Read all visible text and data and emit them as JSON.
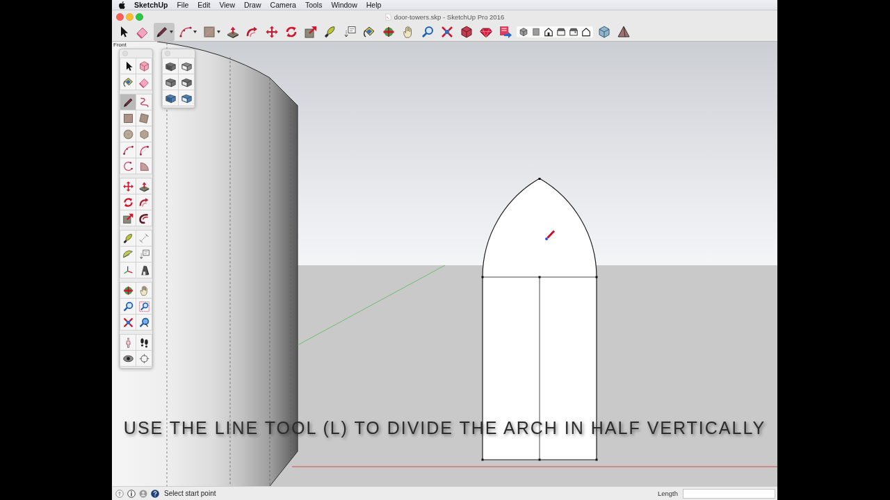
{
  "menu_bar": {
    "app_name": "SketchUp",
    "menus": [
      "File",
      "Edit",
      "View",
      "Draw",
      "Camera",
      "Tools",
      "Window",
      "Help"
    ]
  },
  "window": {
    "title": "door-towers.skp - SketchUp Pro 2016"
  },
  "toolbar": {
    "main_tools": [
      {
        "selected": false,
        "dropdown": false
      },
      {
        "selected": false,
        "dropdown": false
      },
      {
        "selected": true,
        "dropdown": true
      },
      {
        "selected": false,
        "dropdown": true
      },
      {
        "selected": false,
        "dropdown": true
      },
      {
        "selected": false,
        "dropdown": false
      },
      {
        "selected": false,
        "dropdown": false
      },
      {
        "selected": false,
        "dropdown": false
      },
      {
        "selected": false,
        "dropdown": false
      },
      {
        "selected": false,
        "dropdown": false
      },
      {
        "selected": false,
        "dropdown": false
      },
      {
        "selected": false,
        "dropdown": false
      },
      {
        "selected": false,
        "dropdown": false
      },
      {
        "selected": false,
        "dropdown": false
      },
      {
        "selected": false,
        "dropdown": false
      },
      {
        "selected": false,
        "dropdown": false
      },
      {
        "selected": false,
        "dropdown": false
      },
      {
        "selected": false,
        "dropdown": false
      },
      {
        "selected": false,
        "dropdown": false
      },
      {
        "selected": false,
        "dropdown": false
      }
    ]
  },
  "viewport": {
    "view_label": "Front",
    "caption": "USE THE LINE TOOL (L) TO DIVIDE THE ARCH IN HALF VERTICALLY"
  },
  "tool_palette": {
    "groups": [
      {
        "tools": [
          {
            "selected": false
          },
          {
            "selected": false
          },
          {
            "selected": false
          },
          {
            "selected": false
          }
        ]
      },
      {
        "tools": [
          {
            "selected": true
          },
          {
            "selected": false
          },
          {
            "selected": false
          },
          {
            "selected": false
          },
          {
            "selected": false
          },
          {
            "selected": false
          },
          {
            "selected": false
          },
          {
            "selected": false
          },
          {
            "selected": false
          },
          {
            "selected": false
          }
        ]
      },
      {
        "tools": [
          {
            "selected": false
          },
          {
            "selected": false
          },
          {
            "selected": false
          },
          {
            "selected": false
          },
          {
            "selected": false
          },
          {
            "selected": false
          }
        ]
      },
      {
        "tools": [
          {
            "selected": false
          },
          {
            "selected": false
          },
          {
            "selected": false
          },
          {
            "selected": false
          },
          {
            "selected": false
          },
          {
            "selected": false
          }
        ]
      },
      {
        "tools": [
          {
            "selected": false
          },
          {
            "selected": false
          },
          {
            "selected": false
          },
          {
            "selected": false
          },
          {
            "selected": false
          },
          {
            "selected": false
          }
        ]
      },
      {
        "tools": [
          {
            "selected": false
          },
          {
            "selected": false
          },
          {
            "selected": false
          },
          {
            "selected": false
          }
        ]
      }
    ]
  },
  "section_palette": {
    "tools": [
      {
        "selected": false
      },
      {
        "selected": false
      },
      {
        "selected": false
      },
      {
        "selected": false
      },
      {
        "selected": false
      },
      {
        "selected": false
      }
    ]
  },
  "status_bar": {
    "message": "Select start point",
    "measurement_label": "Length"
  }
}
